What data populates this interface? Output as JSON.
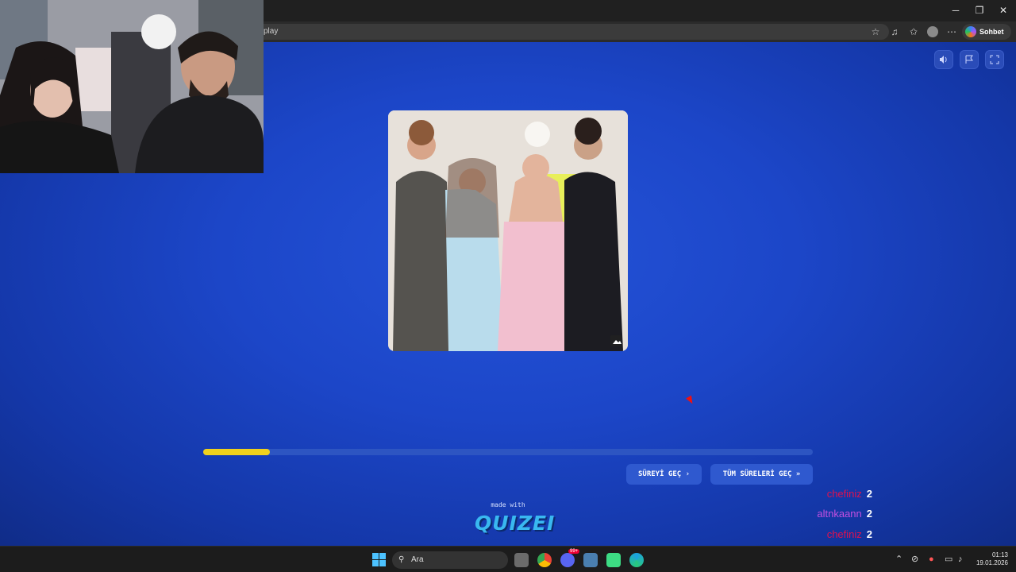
{
  "browser": {
    "url": "play",
    "copilot_label": "Sohbet et",
    "window_controls": [
      "minimize-icon",
      "restore-icon",
      "close-icon"
    ],
    "toolbar_icons": [
      "star-icon",
      "extensions-icon",
      "favorites-icon",
      "profile-icon",
      "more-icon"
    ]
  },
  "quiz": {
    "controls": [
      "sound-icon",
      "flag-icon",
      "fullscreen-icon"
    ],
    "progress": 0.11,
    "progress_color": "#f0d11c",
    "skip_button": "SÜREYİ GEÇ ›",
    "skip_all_button": "TÜM SÜRELERİ GEÇ »",
    "made_with": "made with",
    "brand": "QUIZEI"
  },
  "chat": [
    {
      "user": "chefiniz",
      "score": "2",
      "color": "#e0114f"
    },
    {
      "user": "altnkaann",
      "score": "2",
      "color": "#c44fe0"
    },
    {
      "user": "chefiniz",
      "score": "2",
      "color": "#e0114f"
    }
  ],
  "taskbar": {
    "search_placeholder": "Ara",
    "apps": [
      "task-view-icon",
      "chrome-icon",
      "discord-icon",
      "app-icon",
      "android-icon",
      "edge-icon"
    ],
    "discord_badge": "99+",
    "time": "01:13",
    "date": "19.01.2026"
  }
}
